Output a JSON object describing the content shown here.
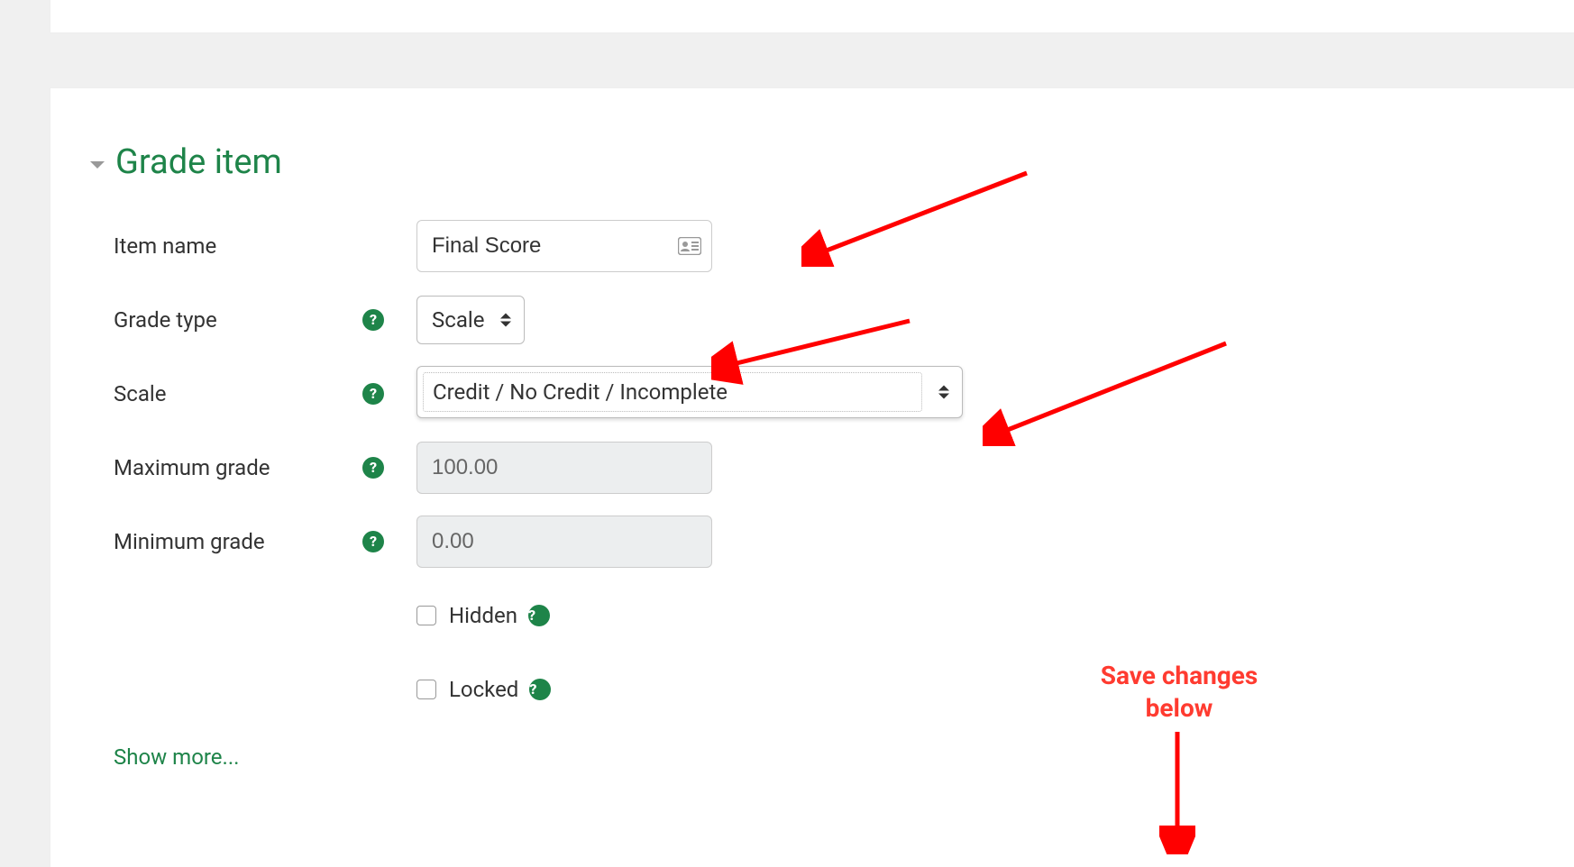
{
  "section": {
    "title": "Grade item"
  },
  "fields": {
    "item_name": {
      "label": "Item name",
      "value": "Final Score"
    },
    "grade_type": {
      "label": "Grade type",
      "value": "Scale"
    },
    "scale": {
      "label": "Scale",
      "value": "Credit / No Credit / Incomplete"
    },
    "max_grade": {
      "label": "Maximum grade",
      "value": "100.00"
    },
    "min_grade": {
      "label": "Minimum grade",
      "value": "0.00"
    },
    "hidden": {
      "label": "Hidden"
    },
    "locked": {
      "label": "Locked"
    }
  },
  "showmore": "Show more...",
  "annotation": {
    "save_text": "Save changes\nbelow"
  },
  "colors": {
    "green": "#1e8449",
    "red": "#ff3b30"
  }
}
